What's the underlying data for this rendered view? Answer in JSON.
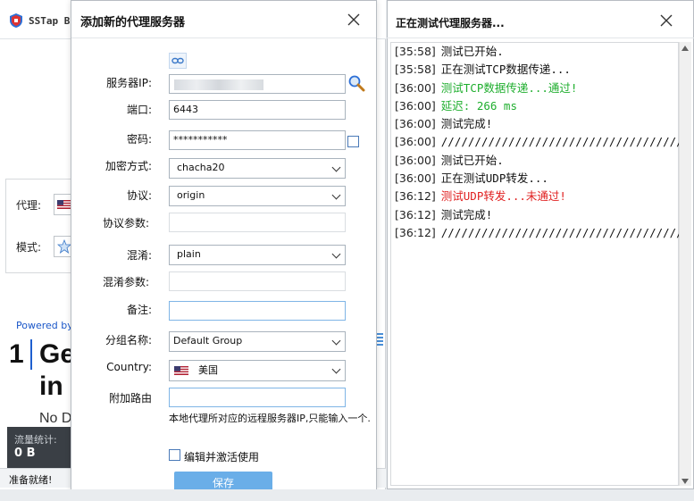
{
  "main_window": {
    "app_title": "SSTap B",
    "proxy_label": "代理:",
    "mode_label": "模式:",
    "powered_by": "Powered by",
    "promo_number": "1",
    "promo_line1": "Ge",
    "promo_line2": "in",
    "promo_line3": "No D",
    "traffic_label": "流量统计:",
    "traffic_value": "0 B",
    "status_text": "准备就绪!"
  },
  "dialog": {
    "title": "添加新的代理服务器",
    "fields": {
      "server_ip": {
        "label": "服务器IP:",
        "value": ""
      },
      "port": {
        "label": "端口:",
        "value": "6443"
      },
      "password": {
        "label": "密码:",
        "value": "***********"
      },
      "encryption": {
        "label": "加密方式:",
        "value": "chacha20"
      },
      "protocol": {
        "label": "协议:",
        "value": "origin"
      },
      "protocol_param": {
        "label": "协议参数:",
        "value": ""
      },
      "obfs": {
        "label": "混淆:",
        "value": "plain"
      },
      "obfs_param": {
        "label": "混淆参数:",
        "value": ""
      },
      "remark": {
        "label": "备注:",
        "value": ""
      },
      "group": {
        "label": "分组名称:",
        "value": "Default Group"
      },
      "country": {
        "label": "Country:",
        "value": "美国"
      },
      "extra_route": {
        "label": "附加路由",
        "value": ""
      }
    },
    "hint": "本地代理所对应的远程服务器IP,只能输入一个.",
    "activate_label": "编辑并激活使用",
    "save_label": "保存"
  },
  "log_window": {
    "title": "正在测试代理服务器...",
    "lines": [
      {
        "time": "[35:58]",
        "text": "测试已开始.",
        "color": "#111111"
      },
      {
        "time": "[35:58]",
        "text": "正在测试TCP数据传递...",
        "color": "#111111"
      },
      {
        "time": "[36:00]",
        "text": "测试TCP数据传递...通过!",
        "color": "#1fae2e"
      },
      {
        "time": "[36:00]",
        "text": "延迟: 266 ms",
        "color": "#1fae2e"
      },
      {
        "time": "[36:00]",
        "text": "测试完成!",
        "color": "#111111"
      },
      {
        "time": "[36:00]",
        "text": "////////////////////////////////////////////////",
        "color": "#111111"
      },
      {
        "time": "[36:00]",
        "text": "测试已开始.",
        "color": "#111111"
      },
      {
        "time": "[36:00]",
        "text": "正在测试UDP转发...",
        "color": "#111111"
      },
      {
        "time": "[36:12]",
        "text": "测试UDP转发...未通过!",
        "color": "#e02020"
      },
      {
        "time": "[36:12]",
        "text": "测试完成!",
        "color": "#111111"
      },
      {
        "time": "[36:12]",
        "text": "////////////////////////////////////////////////",
        "color": "#111111"
      }
    ]
  },
  "colors": {
    "accent": "#6aaee8",
    "success": "#1fae2e",
    "failure": "#e02020"
  }
}
